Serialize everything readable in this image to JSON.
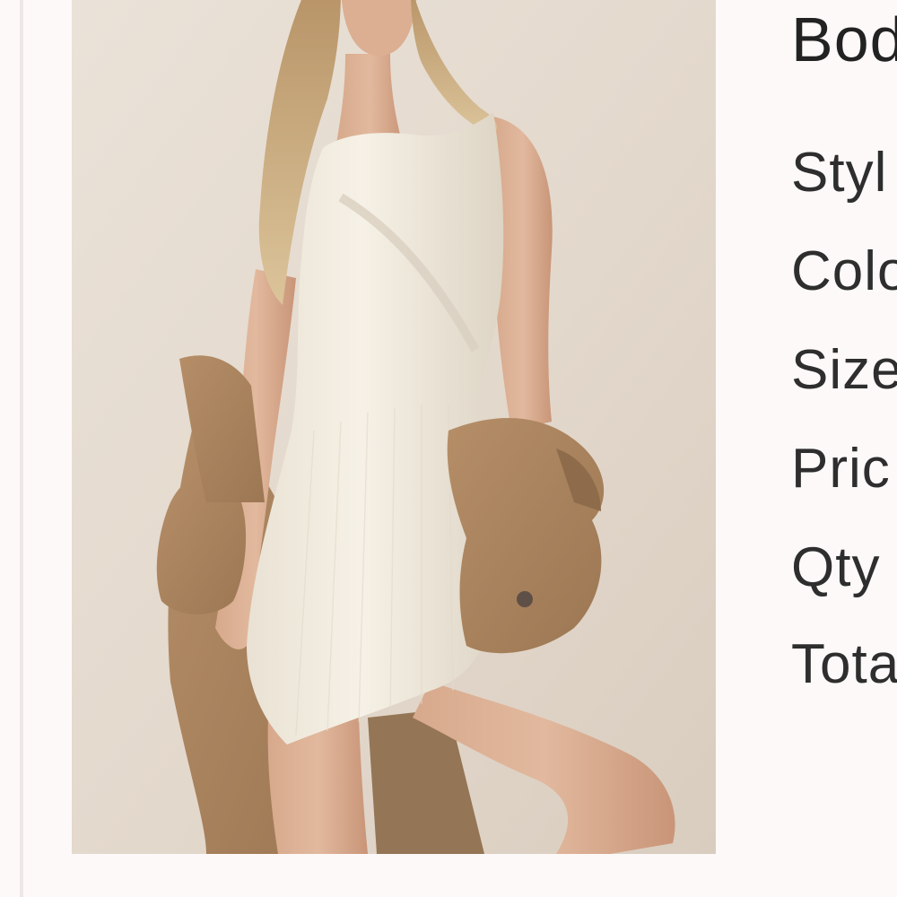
{
  "product": {
    "title": "Bod",
    "image_alt": "Model wearing ivory sleeveless ribbed mini dress with tan jacket"
  },
  "details": {
    "style_label": "Styl",
    "color_label": "Colo",
    "size_label": "Size",
    "price_label": "Pric",
    "qty_label": "Qty",
    "total_label": "Tota"
  }
}
